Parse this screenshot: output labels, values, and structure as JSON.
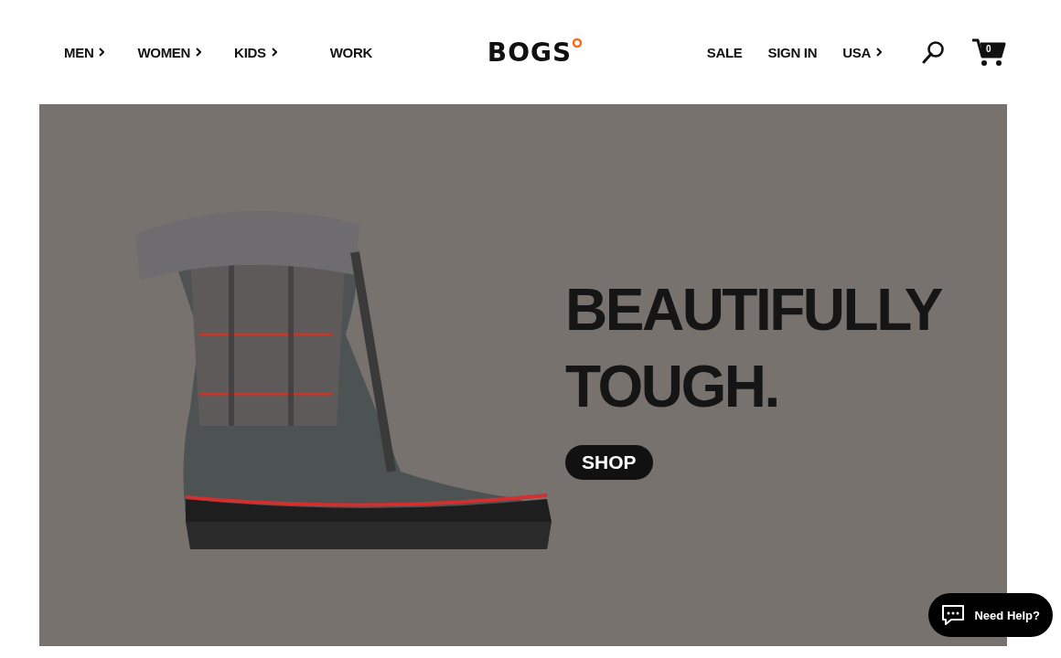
{
  "header": {
    "nav_left": [
      {
        "label": "MEN",
        "has_menu": true
      },
      {
        "label": "WOMEN",
        "has_menu": true
      },
      {
        "label": "KIDS",
        "has_menu": true
      },
      {
        "label": "WORK",
        "has_menu": false
      }
    ],
    "logo": "BOGS",
    "nav_right": [
      {
        "label": "SALE",
        "has_menu": false
      },
      {
        "label": "SIGN IN",
        "has_menu": false
      },
      {
        "label": "USA",
        "has_menu": true
      }
    ],
    "cart_count": "0"
  },
  "hero": {
    "headline": "BEAUTIFULLY TOUGH.",
    "button": "SHOP"
  },
  "chat": {
    "label": "Need Help?"
  }
}
